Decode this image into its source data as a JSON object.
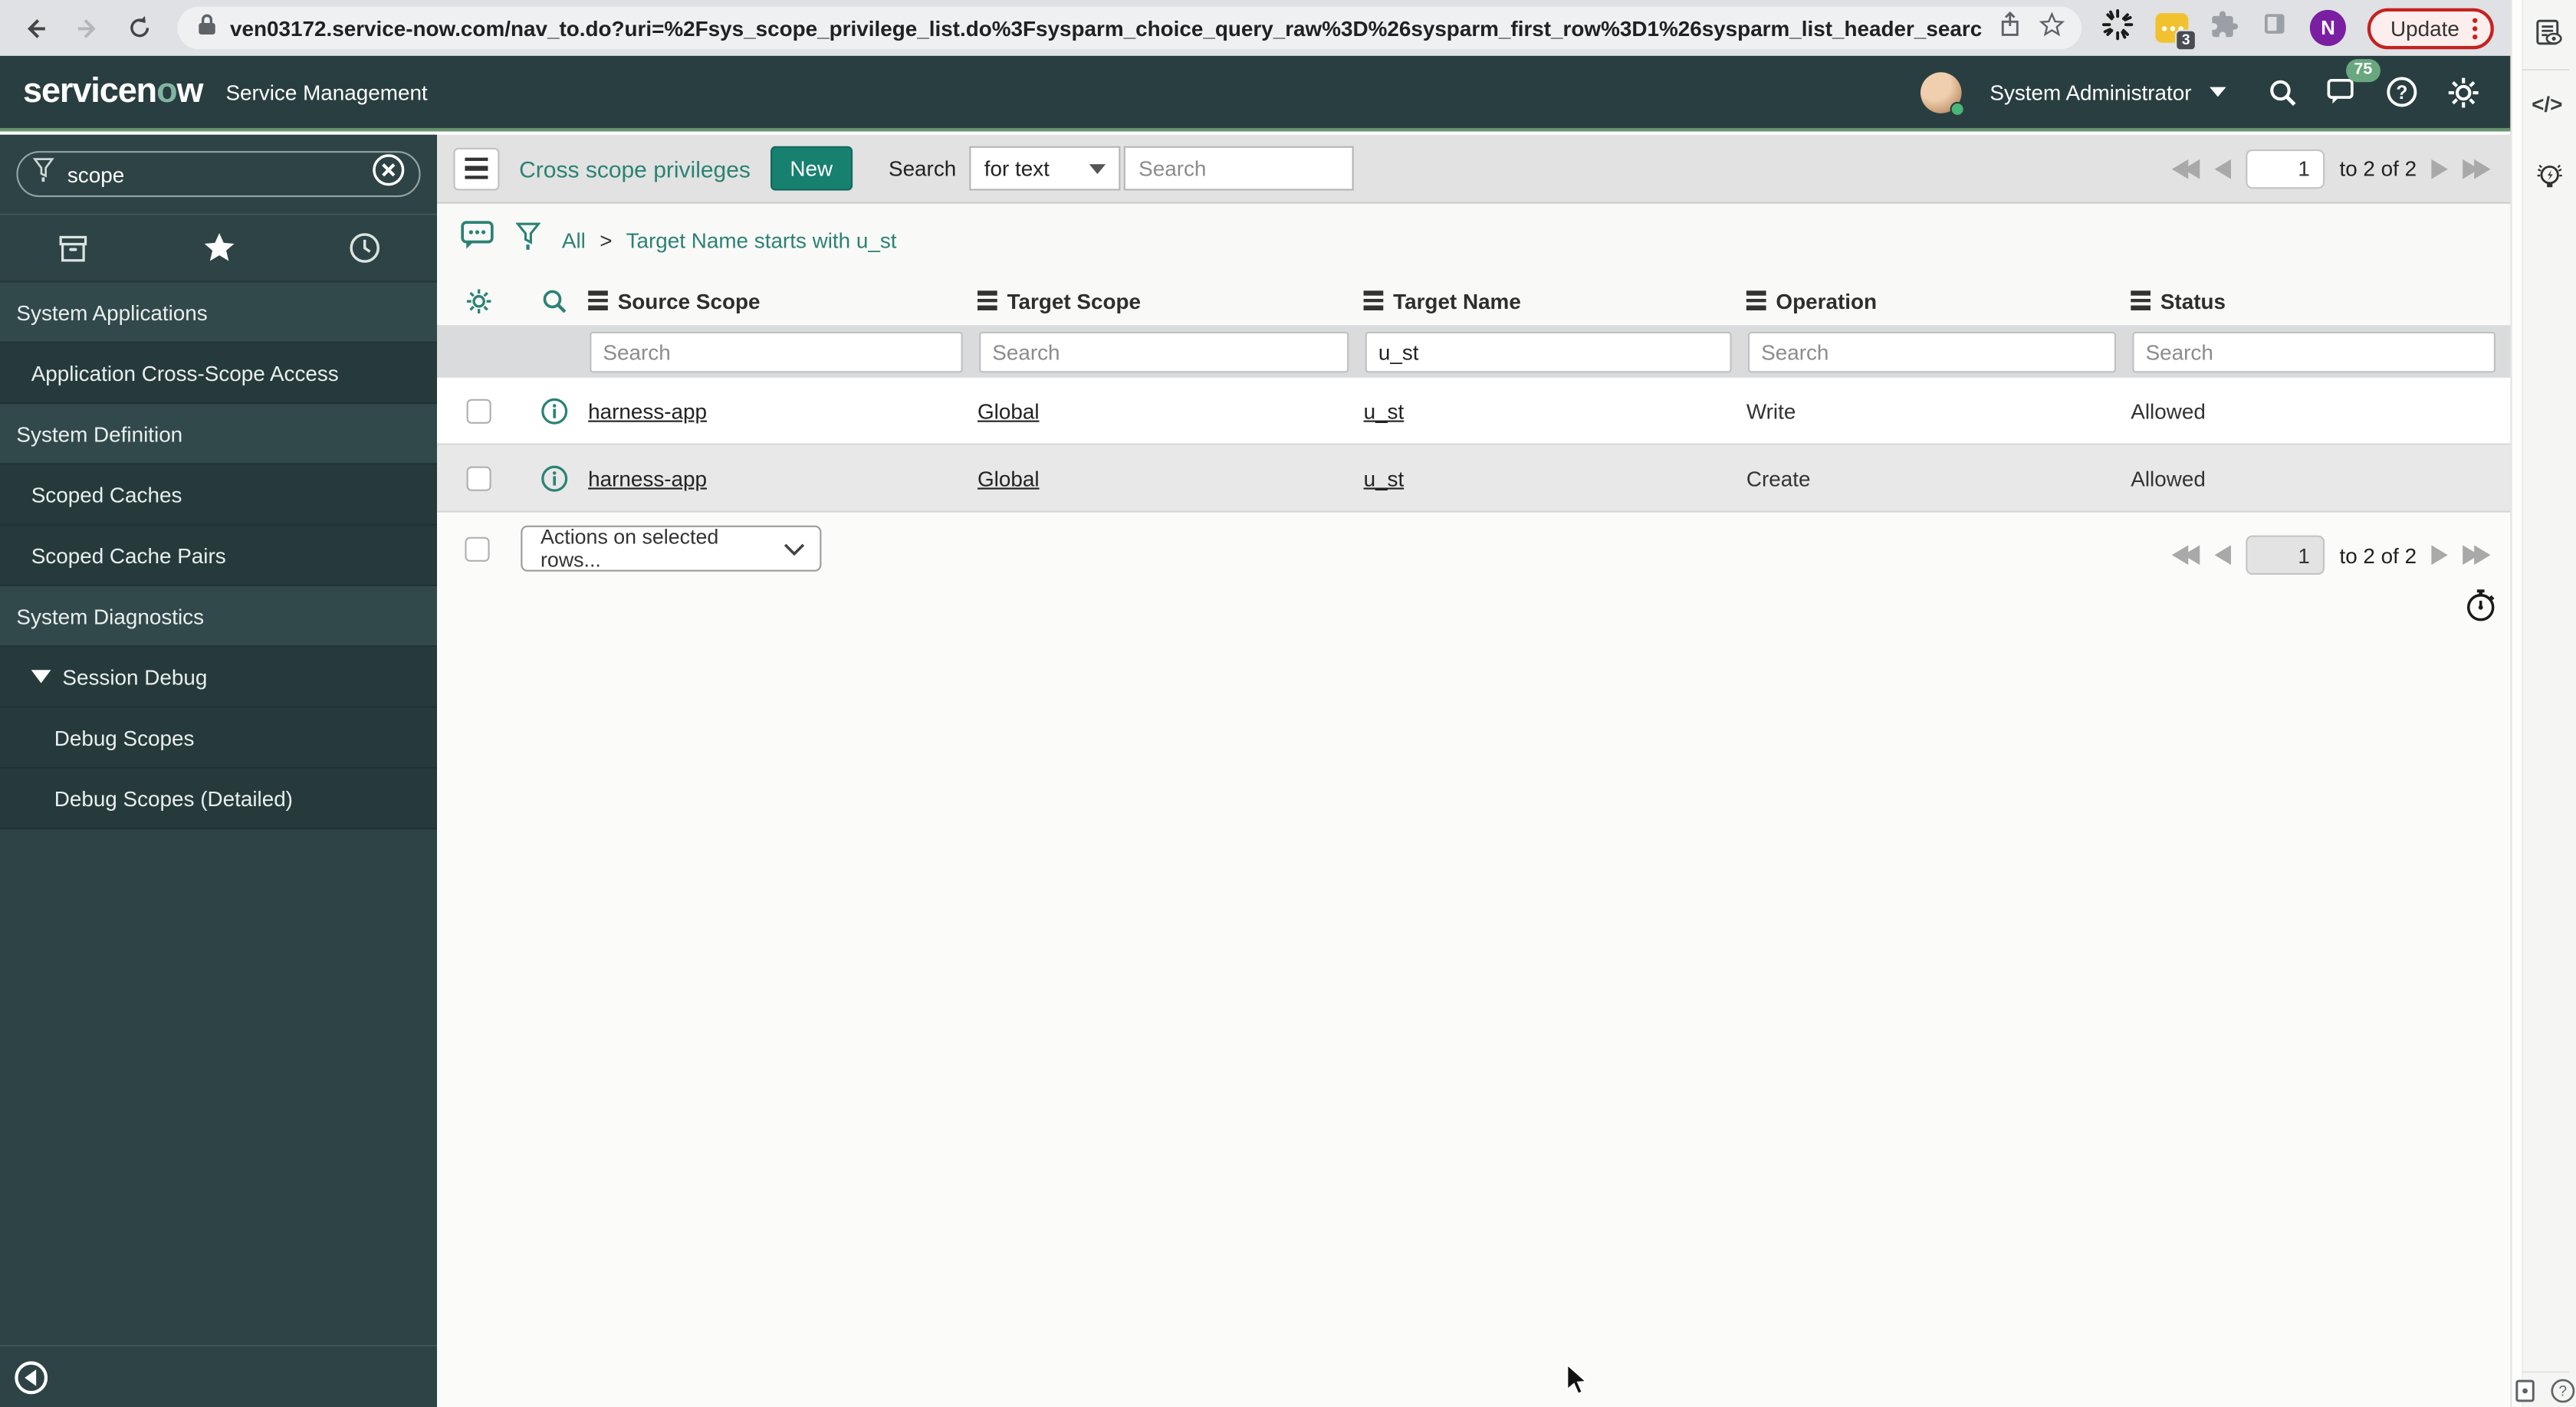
{
  "browser": {
    "url": "ven03172.service-now.com/nav_to.do?uri=%2Fsys_scope_privilege_list.do%3Fsysparm_choice_query_raw%3D%26sysparm_first_row%3D1%26sysparm_list_header_searc...",
    "update_label": "Update",
    "extensions_badge": "3",
    "profile_initial": "N"
  },
  "snc_header": {
    "logo_pre": "servicen",
    "logo_o": "o",
    "logo_post": "w",
    "product": "Service Management",
    "user_name": "System Administrator",
    "chat_badge": "75"
  },
  "sidebar": {
    "search_value": "scope",
    "items": [
      {
        "label": "System Applications",
        "type": "header"
      },
      {
        "label": "Application Cross-Scope Access",
        "type": "child"
      },
      {
        "label": "System Definition",
        "type": "header"
      },
      {
        "label": "Scoped Caches",
        "type": "child"
      },
      {
        "label": "Scoped Cache Pairs",
        "type": "child"
      },
      {
        "label": "System Diagnostics",
        "type": "header"
      },
      {
        "label": "Session Debug",
        "type": "expandable"
      },
      {
        "label": "Debug Scopes",
        "type": "subchild"
      },
      {
        "label": "Debug Scopes (Detailed)",
        "type": "subchild"
      }
    ]
  },
  "toolbar": {
    "title": "Cross scope privileges",
    "new_label": "New",
    "search_label": "Search",
    "search_type": "for text",
    "search_placeholder": "Search"
  },
  "breadcrumb": {
    "root": "All",
    "separator": ">",
    "filter": "Target Name starts with u_st"
  },
  "pagination": {
    "page": "1",
    "range_label": "to 2 of 2"
  },
  "list": {
    "columns": [
      "Source Scope",
      "Target Scope",
      "Target Name",
      "Operation",
      "Status"
    ],
    "filter_placeholders": [
      "Search",
      "Search",
      "",
      "Search",
      "Search"
    ],
    "filter_values": [
      "",
      "",
      "u_st",
      "",
      ""
    ],
    "link_columns": [
      0,
      1,
      2
    ],
    "rows": [
      [
        "harness-app",
        "Global",
        "u_st",
        "Write",
        "Allowed"
      ],
      [
        "harness-app",
        "Global",
        "u_st",
        "Create",
        "Allowed"
      ]
    ],
    "actions_placeholder": "Actions on selected rows..."
  },
  "icons": {
    "back-icon": "left-arrow",
    "forward-icon": "right-arrow",
    "reload-icon": "circular-arrow",
    "lock-icon": "padlock",
    "share-icon": "box-up-arrow",
    "bookmark-star-icon": "star-outline",
    "spinner-icon": "loading-starburst",
    "chat-extension-icon": "yellow-bubble",
    "extensions-puzzle-icon": "puzzle-piece",
    "side-panel-icon": "panel-rect",
    "search-icon": "magnifier",
    "notifications-icon": "chat-bubble",
    "help-icon": "question-circle",
    "settings-gear-icon": "gear",
    "filter-funnel-icon": "funnel",
    "clear-icon": "circle-x",
    "applications-icon": "archive-box",
    "favorites-icon": "star-filled",
    "history-icon": "clock",
    "comments-icon": "speech-bubble-dots",
    "info-icon": "circle-i",
    "timer-icon": "stopwatch",
    "reading-list-icon": "doc-eye",
    "code-panel-icon": "angle-brackets",
    "hints-icon": "lightbulb-bolt"
  },
  "colors": {
    "accent_teal": "#2b8274",
    "header_bg": "#293e40",
    "new_button": "#17806f",
    "update_red": "#c5221f",
    "badge_green": "#69a77e"
  }
}
